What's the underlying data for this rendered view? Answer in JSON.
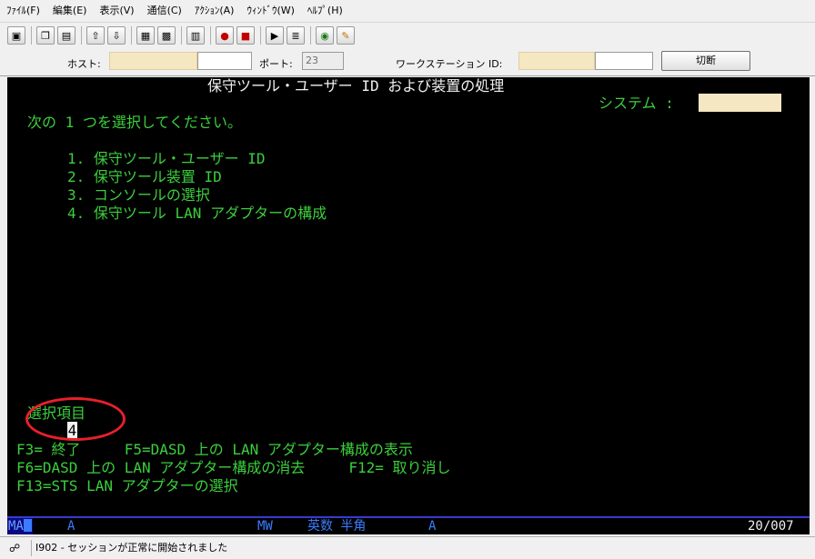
{
  "menu": [
    "ﾌｧｲﾙ(F)",
    "編集(E)",
    "表示(V)",
    "通信(C)",
    "ｱｸｼｮﾝ(A)",
    "ｳｨﾝﾄﾞｳ(W)",
    "ﾍﾙﾌﾟ(H)"
  ],
  "connection": {
    "host_label": "ホスト:",
    "host_value": "",
    "port_label": "ポート:",
    "port_value": "23",
    "workstation_label": "ワークステーション ID:",
    "workstation_value": "",
    "disconnect_label": "切断"
  },
  "terminal": {
    "title": "保守ツール・ユーザー ID および装置の処理",
    "system_label": "システム :",
    "system_value": "",
    "instruction": "次の 1 つを選択してください。",
    "options": [
      "1. 保守ツール・ユーザー ID",
      "2. 保守ツール装置 ID",
      "3. コンソールの選択",
      "4. 保守ツール LAN アダプターの構成"
    ],
    "selection_label": "選択項目",
    "selection_value": "4",
    "fkeys": [
      "F3= 終了     F5=DASD 上の LAN アダプター構成の表示",
      "F6=DASD 上の LAN アダプター構成の消去     F12= 取り消し",
      "F13=STS LAN アダプターの選択"
    ]
  },
  "oia": {
    "ma": "MA",
    "a1": "A",
    "mw": "MW",
    "input_mode": "英数 半角",
    "a2": "A",
    "cursor_pos": "20/007"
  },
  "status": {
    "message": "I902 - セッションが正常に開始されました"
  },
  "colors": {
    "terminal_text": "#3ccf3c",
    "field_highlight": "#f5e7c2",
    "annotation_ring": "#e8202a"
  }
}
